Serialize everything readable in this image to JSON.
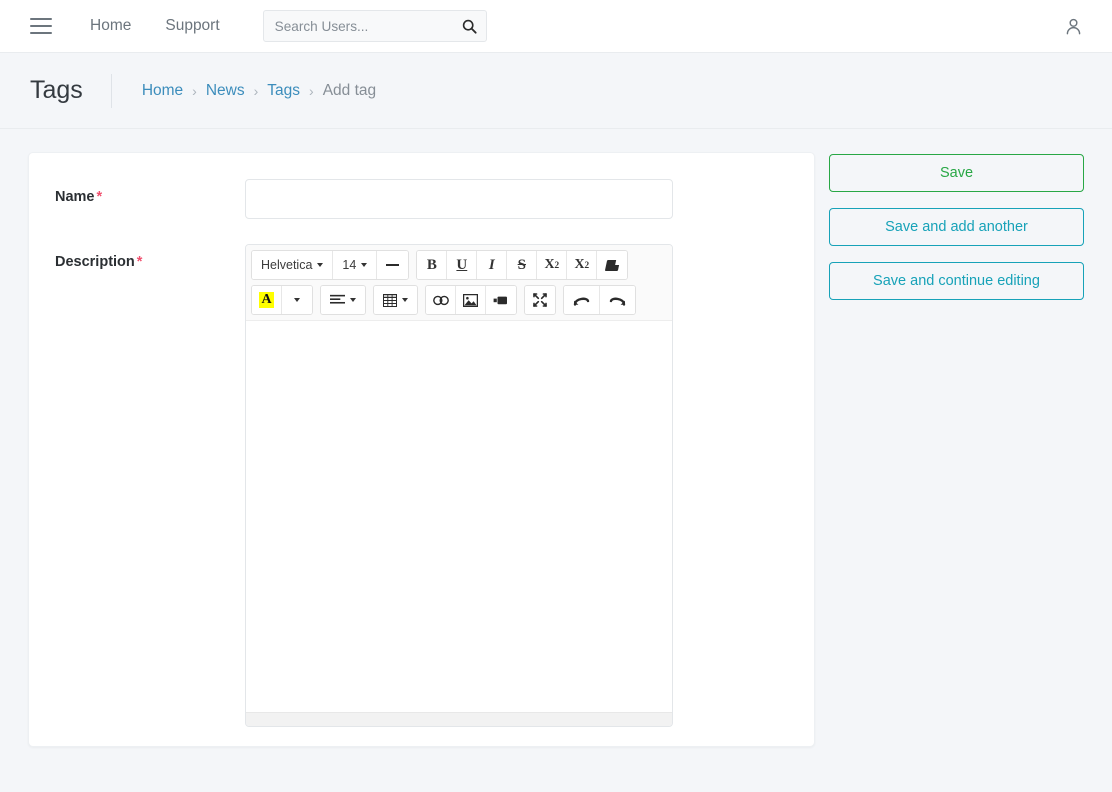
{
  "topnav": {
    "menu_icon": "hamburger-icon",
    "links": [
      {
        "label": "Home"
      },
      {
        "label": "Support"
      }
    ],
    "search": {
      "placeholder": "Search Users...",
      "value": "",
      "icon": "search-icon"
    },
    "user_icon": "user-icon"
  },
  "header": {
    "title": "Tags",
    "breadcrumb": [
      {
        "label": "Home",
        "link": true
      },
      {
        "label": "News",
        "link": true
      },
      {
        "label": "Tags",
        "link": true
      },
      {
        "label": "Add tag",
        "link": false
      }
    ],
    "separator": "›"
  },
  "form": {
    "name": {
      "label": "Name",
      "required_marker": "*",
      "value": "",
      "placeholder": ""
    },
    "description": {
      "label": "Description",
      "required_marker": "*",
      "value": ""
    }
  },
  "editor": {
    "font_family": "Helvetica",
    "font_size": "14",
    "caret": "▾",
    "toolbar_row1": [
      {
        "name": "font-family-select",
        "label": "Helvetica",
        "icon": "chevron-down-icon"
      },
      {
        "name": "font-size-select",
        "label": "14",
        "icon": "chevron-down-icon"
      },
      {
        "name": "horizontal-rule-button",
        "label": "",
        "icon": "horizontal-rule-icon"
      },
      {
        "name": "bold-button",
        "label": "B",
        "icon": "bold-icon"
      },
      {
        "name": "underline-button",
        "label": "U",
        "icon": "underline-icon"
      },
      {
        "name": "italic-button",
        "label": "I",
        "icon": "italic-icon"
      },
      {
        "name": "strikethrough-button",
        "label": "S",
        "icon": "strikethrough-icon"
      },
      {
        "name": "superscript-button",
        "label": "X",
        "sup": "2",
        "icon": "superscript-icon"
      },
      {
        "name": "subscript-button",
        "label": "X",
        "sub": "2",
        "icon": "subscript-icon"
      },
      {
        "name": "clear-formatting-button",
        "label": "",
        "icon": "eraser-icon"
      }
    ],
    "toolbar_row2": [
      {
        "name": "text-color-button",
        "label": "A",
        "icon": "text-color-icon"
      },
      {
        "name": "text-color-dropdown",
        "label": "",
        "icon": "chevron-down-icon"
      },
      {
        "name": "align-button",
        "label": "",
        "icon": "align-left-icon"
      },
      {
        "name": "table-button",
        "label": "",
        "icon": "table-icon"
      },
      {
        "name": "insert-link-button",
        "label": "",
        "icon": "link-icon"
      },
      {
        "name": "insert-image-button",
        "label": "",
        "icon": "image-icon"
      },
      {
        "name": "insert-video-button",
        "label": "",
        "icon": "video-icon"
      },
      {
        "name": "fullscreen-button",
        "label": "",
        "icon": "fullscreen-icon"
      },
      {
        "name": "undo-button",
        "label": "",
        "icon": "undo-icon"
      },
      {
        "name": "redo-button",
        "label": "",
        "icon": "redo-icon"
      }
    ],
    "content": ""
  },
  "actions": [
    {
      "label": "Save",
      "style": "save",
      "name": "save-button"
    },
    {
      "label": "Save and add another",
      "style": "info",
      "name": "save-and-add-another-button"
    },
    {
      "label": "Save and continue editing",
      "style": "info",
      "name": "save-and-continue-editing-button"
    }
  ],
  "colors": {
    "page_background": "#f4f6f9",
    "card_background": "#ffffff",
    "link": "#3c8dbc",
    "save_green": "#28a745",
    "info_teal": "#17a2b8",
    "required_red": "#f0506e",
    "highlight_yellow": "#ffff00"
  }
}
